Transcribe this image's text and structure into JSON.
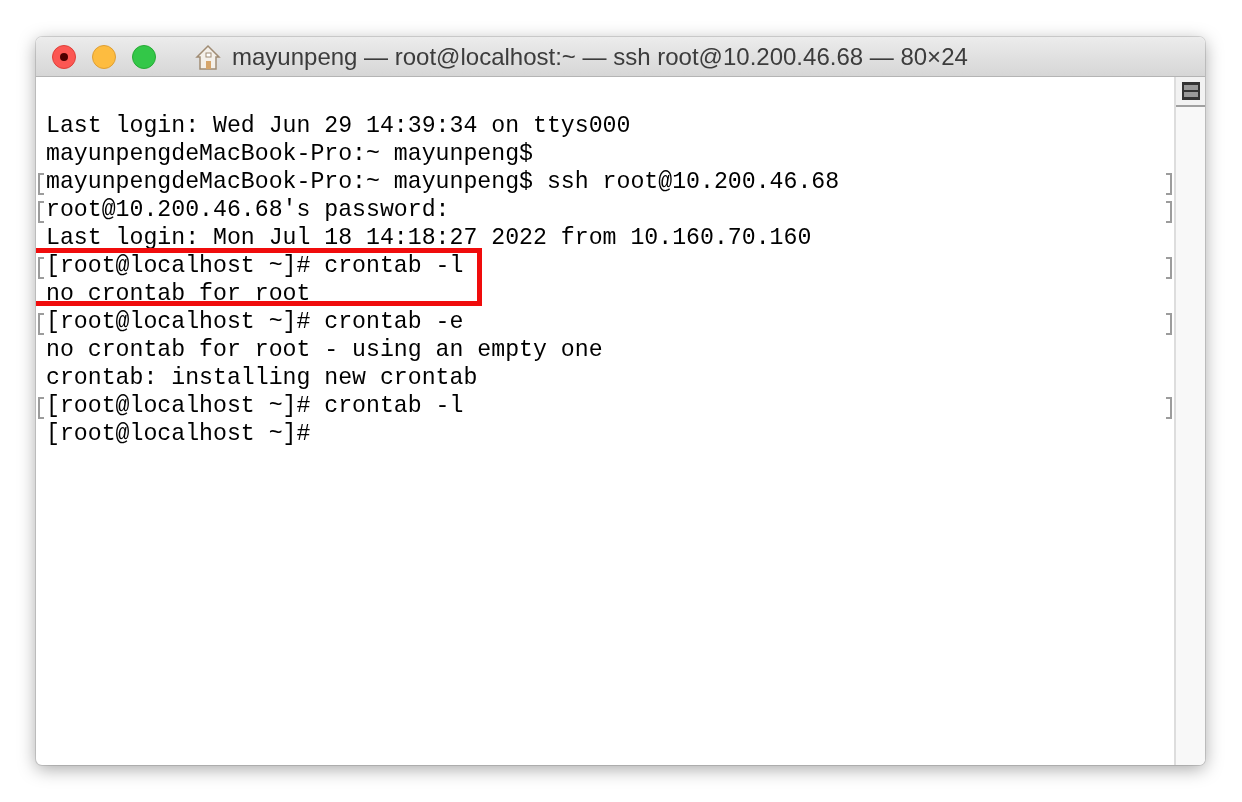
{
  "window": {
    "title": "mayunpeng — root@localhost:~ — ssh root@10.200.46.68 — 80×24"
  },
  "lines": [
    {
      "text": "Last login: Wed Jun 29 14:39:34 on ttys000",
      "marked": false,
      "highlighted": false
    },
    {
      "text": "mayunpengdeMacBook-Pro:~ mayunpeng$",
      "marked": false,
      "highlighted": false
    },
    {
      "text": "mayunpengdeMacBook-Pro:~ mayunpeng$ ssh root@10.200.46.68",
      "marked": true,
      "highlighted": false
    },
    {
      "text": "root@10.200.46.68's password:",
      "marked": true,
      "highlighted": false
    },
    {
      "text": "Last login: Mon Jul 18 14:18:27 2022 from 10.160.70.160",
      "marked": false,
      "highlighted": false
    },
    {
      "text": "[root@localhost ~]# crontab -l",
      "marked": true,
      "highlighted": true
    },
    {
      "text": "no crontab for root",
      "marked": false,
      "highlighted": true
    },
    {
      "text": "[root@localhost ~]# crontab -e",
      "marked": true,
      "highlighted": false
    },
    {
      "text": "no crontab for root - using an empty one",
      "marked": false,
      "highlighted": false
    },
    {
      "text": "crontab: installing new crontab",
      "marked": false,
      "highlighted": false
    },
    {
      "text": "[root@localhost ~]# crontab -l",
      "marked": true,
      "highlighted": false
    },
    {
      "text": "[root@localhost ~]#",
      "marked": false,
      "highlighted": false
    }
  ]
}
